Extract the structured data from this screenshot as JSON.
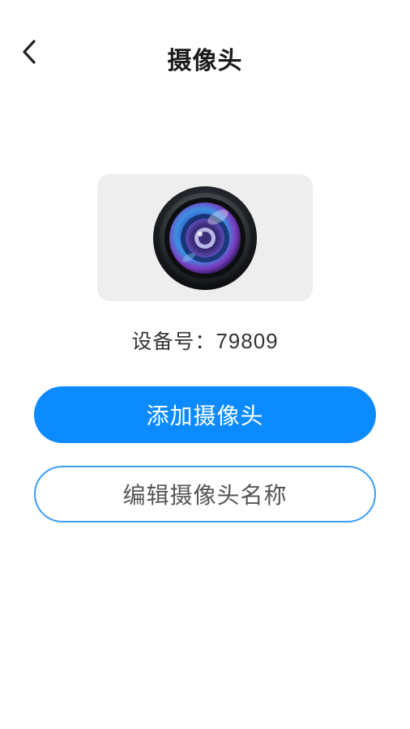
{
  "header": {
    "title": "摄像头",
    "back_icon": "chevron-left-icon"
  },
  "device": {
    "image_icon": "camera-lens-icon",
    "number_label": "设备号：",
    "number_value": "79809"
  },
  "actions": {
    "add_label": "添加摄像头",
    "edit_name_label": "编辑摄像头名称"
  },
  "colors": {
    "primary": "#0b8bff",
    "outline_border": "#3a9df5",
    "card_background": "#eeeeee"
  }
}
